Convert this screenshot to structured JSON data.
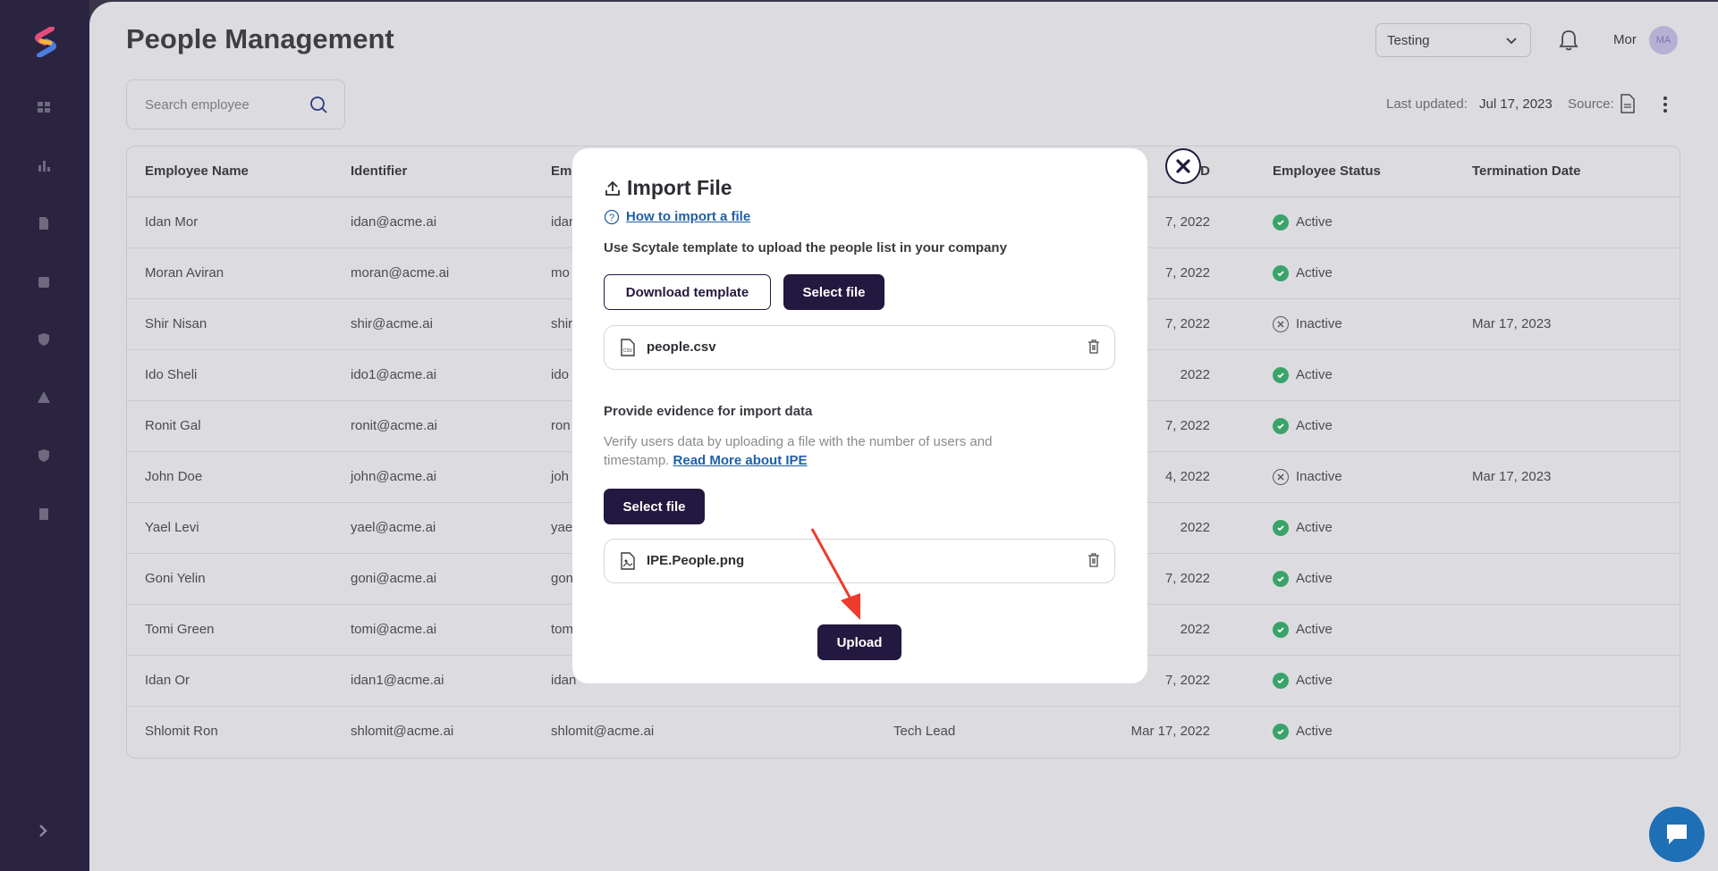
{
  "page": {
    "title": "People Management"
  },
  "header": {
    "workspace_select": "Testing",
    "user_name": "Mor",
    "user_initials": "MA"
  },
  "search": {
    "placeholder": "Search employee"
  },
  "meta": {
    "last_updated_label": "Last updated:",
    "last_updated_value": "Jul 17, 2023",
    "source_label": "Source:"
  },
  "table": {
    "columns": [
      "Employee Name",
      "Identifier",
      "Em",
      "",
      "g D",
      "Employee Status",
      "Termination Date"
    ],
    "rows": [
      {
        "name": "Idan Mor",
        "identifier": "idan@acme.ai",
        "email": "idan",
        "role": "",
        "date": "7, 2022",
        "status": "Active",
        "termination": ""
      },
      {
        "name": "Moran Aviran",
        "identifier": "moran@acme.ai",
        "email": "mo",
        "role": "",
        "date": "7, 2022",
        "status": "Active",
        "termination": ""
      },
      {
        "name": "Shir Nisan",
        "identifier": "shir@acme.ai",
        "email": "shir",
        "role": "",
        "date": "7, 2022",
        "status": "Inactive",
        "termination": "Mar 17, 2023"
      },
      {
        "name": "Ido Sheli",
        "identifier": "ido1@acme.ai",
        "email": "ido",
        "role": "",
        "date": "2022",
        "status": "Active",
        "termination": ""
      },
      {
        "name": "Ronit Gal",
        "identifier": "ronit@acme.ai",
        "email": "ron",
        "role": "",
        "date": "7, 2022",
        "status": "Active",
        "termination": ""
      },
      {
        "name": "John Doe",
        "identifier": "john@acme.ai",
        "email": "joh",
        "role": "",
        "date": "4, 2022",
        "status": "Inactive",
        "termination": "Mar 17, 2023"
      },
      {
        "name": "Yael Levi",
        "identifier": "yael@acme.ai",
        "email": "yae",
        "role": "",
        "date": "2022",
        "status": "Active",
        "termination": ""
      },
      {
        "name": "Goni Yelin",
        "identifier": "goni@acme.ai",
        "email": "gon",
        "role": "",
        "date": "7, 2022",
        "status": "Active",
        "termination": ""
      },
      {
        "name": "Tomi Green",
        "identifier": "tomi@acme.ai",
        "email": "tom",
        "role": "",
        "date": "2022",
        "status": "Active",
        "termination": ""
      },
      {
        "name": "Idan Or",
        "identifier": "idan1@acme.ai",
        "email": "idan",
        "role": "",
        "date": "7, 2022",
        "status": "Active",
        "termination": ""
      },
      {
        "name": "Shlomit Ron",
        "identifier": "shlomit@acme.ai",
        "email": "shlomit@acme.ai",
        "role": "Tech Lead",
        "date": "Mar 17, 2022",
        "status": "Active",
        "termination": ""
      }
    ]
  },
  "modal": {
    "title": "Import File",
    "help_link": "How to import a file",
    "instruction": "Use Scytale template to upload the people list in your company",
    "download_template": "Download template",
    "select_file": "Select file",
    "file1": "people.csv",
    "evidence_title": "Provide evidence for import data",
    "evidence_desc": "Verify users data by uploading a file with the number of users and timestamp.",
    "evidence_link": "Read More about IPE",
    "select_file_2": "Select file",
    "file2": "IPE.People.png",
    "upload": "Upload"
  },
  "colors": {
    "brand_dark": "#23183f",
    "link": "#1f5fa8",
    "active_green": "#3aa36a",
    "arrow_red": "#ee3b2b"
  }
}
